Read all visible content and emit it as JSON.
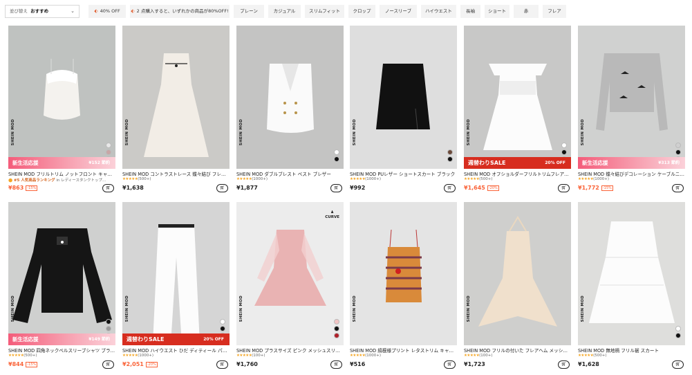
{
  "filter_bar": {
    "sort_label": "並び替え",
    "sort_value": "おすすめ",
    "chips": [
      {
        "label": "40% OFF",
        "tag": true
      },
      {
        "label": "2 点購入すると、いずれかの商品が80%OFF!",
        "tag": true
      },
      {
        "label": "プレーン",
        "tag": false
      },
      {
        "label": "カジュアル",
        "tag": false
      },
      {
        "label": "スリムフィット",
        "tag": false
      },
      {
        "label": "クロップ",
        "tag": false
      },
      {
        "label": "ノースリーブ",
        "tag": false
      },
      {
        "label": "ハイウエスト",
        "tag": false
      },
      {
        "label": "長袖",
        "tag": false
      },
      {
        "label": "ショート",
        "tag": false
      },
      {
        "label": "赤",
        "tag": false
      },
      {
        "label": "フレア",
        "tag": false
      }
    ]
  },
  "brand_vertical": "SHEIN MOD",
  "curve_label": "CURVE",
  "stars": "★★★★★",
  "products": [
    {
      "title": "SHEIN MOD フリルトリム ノットフロント キャミソール",
      "rank": "#5 人気商品ランキング",
      "rank_in": "in",
      "rank_cat": "レディースタンクトップ…",
      "count": "",
      "price": "¥863",
      "discount": "-15%",
      "banner_type": "spring",
      "banner_left": "新生活応援",
      "banner_right": "¥152 節約",
      "swatches": [
        "#e8e8e8",
        "#c9a6a6",
        "#ffffff"
      ]
    },
    {
      "title": "SHEIN MOD コントラストレース 蝶々結び フレアドレス",
      "rank": "",
      "rank_in": "",
      "rank_cat": "",
      "count": "(500+)",
      "price": "¥1,638",
      "discount": "",
      "banner_type": "",
      "banner_left": "",
      "banner_right": "",
      "swatches": []
    },
    {
      "title": "SHEIN MOD ダブルブレスト ベスト ブレザー",
      "rank": "",
      "rank_in": "",
      "rank_cat": "",
      "count": "(1000+)",
      "price": "¥1,877",
      "discount": "",
      "banner_type": "",
      "banner_left": "",
      "banner_right": "",
      "swatches": [
        "#ffffff",
        "#111111"
      ]
    },
    {
      "title": "SHEIN MOD PUレザー ショートスカート ブラック",
      "rank": "",
      "rank_in": "",
      "rank_cat": "",
      "count": "(1000+)",
      "price": "¥992",
      "discount": "",
      "banner_type": "",
      "banner_left": "",
      "banner_right": "",
      "swatches": [
        "#6b4a3a",
        "#111111"
      ]
    },
    {
      "title": "SHEIN MOD オフショルダーフリルトリムフレアドレス",
      "rank": "",
      "rank_in": "",
      "rank_cat": "",
      "count": "(500+)",
      "price": "¥1,645",
      "discount": "-20%",
      "banner_type": "sale",
      "banner_left": "週替わりSALE",
      "banner_right": "20% OFF",
      "swatches": [
        "#ffffff",
        "#111111",
        "#d8d8d8"
      ]
    },
    {
      "title": "SHEIN MOD 蝶々結びデコレーション ケーブルニット",
      "rank": "",
      "rank_in": "",
      "rank_cat": "",
      "count": "(1000+)",
      "price": "¥1,772",
      "discount": "-15%",
      "banner_type": "spring",
      "banner_left": "新生活応援",
      "banner_right": "¥313 節約",
      "swatches": [
        "#d0d0d0",
        "#111111",
        "#ffffff"
      ]
    },
    {
      "title": "SHEIN MOD 四角ネックベルスリーブシャツ ブラック",
      "rank": "",
      "rank_in": "",
      "rank_cat": "",
      "count": "(500+)",
      "price": "¥844",
      "discount": "-15%",
      "banner_type": "spring",
      "banner_left": "新生活応援",
      "banner_right": "¥149 節約",
      "swatches": [
        "#111111",
        "#9a9a9a",
        "#ffffff"
      ]
    },
    {
      "title": "SHEIN MOD ハイウエスト ひだ ディティール パンツ",
      "rank": "",
      "rank_in": "",
      "rank_cat": "",
      "count": "(1000+)",
      "price": "¥2,051",
      "discount": "-20%",
      "banner_type": "sale",
      "banner_left": "週替わりSALE",
      "banner_right": "20% OFF",
      "swatches": [
        "#ffffff",
        "#111111",
        "#d64c7c"
      ]
    },
    {
      "title": "SHEIN MOD プラスサイズ ピンク メッシュスリーブドレス",
      "rank": "",
      "rank_in": "",
      "rank_cat": "",
      "count": "(100+)",
      "price": "¥1,760",
      "discount": "",
      "banner_type": "",
      "banner_left": "",
      "banner_right": "",
      "swatches": [
        "#f2c4c4",
        "#111111",
        "#b0202a"
      ],
      "curve": true
    },
    {
      "title": "SHEIN MOD 縞模様プリント レタストリム キャミトップ",
      "rank": "",
      "rank_in": "",
      "rank_cat": "",
      "count": "(1000+)",
      "price": "¥516",
      "discount": "",
      "banner_type": "",
      "banner_left": "",
      "banner_right": "",
      "swatches": []
    },
    {
      "title": "SHEIN MOD フリルの付いた フレアヘム メッシュトップ",
      "rank": "",
      "rank_in": "",
      "rank_cat": "",
      "count": "(100+)",
      "price": "¥1,723",
      "discount": "",
      "banner_type": "",
      "banner_left": "",
      "banner_right": "",
      "swatches": []
    },
    {
      "title": "SHEIN MOD 無地柄 フリル裾 スカート",
      "rank": "",
      "rank_in": "",
      "rank_cat": "",
      "count": "(500+)",
      "price": "¥1,628",
      "discount": "",
      "banner_type": "",
      "banner_left": "",
      "banner_right": "",
      "swatches": [
        "#ffffff",
        "#111111"
      ]
    }
  ]
}
